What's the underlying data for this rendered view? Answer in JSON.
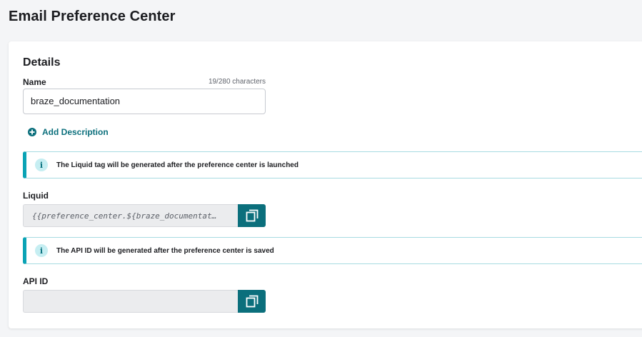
{
  "page": {
    "title": "Email Preference Center"
  },
  "details": {
    "section_title": "Details",
    "name_label": "Name",
    "char_count": "19/280 characters",
    "name_value": "braze_documentation",
    "add_description_label": "Add Description"
  },
  "liquid": {
    "alert_text": "The Liquid tag will be generated after the preference center is launched",
    "label": "Liquid",
    "value": "{{preference_center.${braze_documentat…"
  },
  "api": {
    "alert_text": "The API ID will be generated after the preference center is saved",
    "label": "API ID",
    "value": ""
  },
  "icons": {
    "info": "i"
  },
  "colors": {
    "accent": "#0b6f7c",
    "alert_border": "#0aa3b5"
  }
}
